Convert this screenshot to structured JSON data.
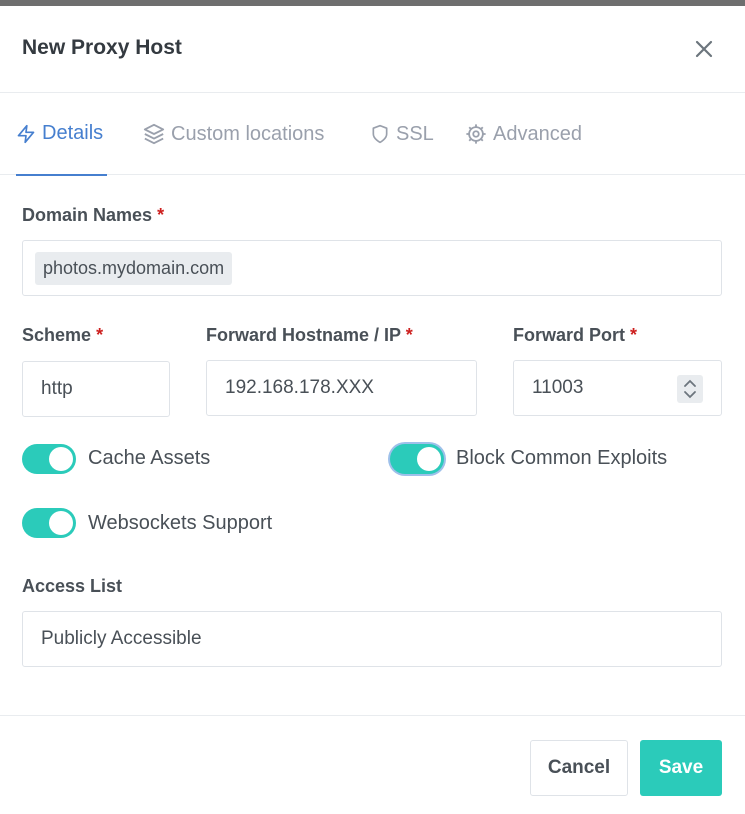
{
  "modal": {
    "title": "New Proxy Host"
  },
  "tabs": [
    {
      "label": "Details",
      "icon": "lightning-icon",
      "active": true
    },
    {
      "label": "Custom locations",
      "icon": "layers-icon",
      "active": false
    },
    {
      "label": "SSL",
      "icon": "shield-icon",
      "active": false
    },
    {
      "label": "Advanced",
      "icon": "gear-icon",
      "active": false
    }
  ],
  "form": {
    "domain_names": {
      "label": "Domain Names",
      "required_mark": "*",
      "tags": [
        "photos.mydomain.com"
      ]
    },
    "scheme": {
      "label": "Scheme",
      "required_mark": "*",
      "value": "http"
    },
    "forward_host": {
      "label": "Forward Hostname / IP",
      "required_mark": "*",
      "value": "192.168.178.XXX"
    },
    "forward_port": {
      "label": "Forward Port",
      "required_mark": "*",
      "value": "11003"
    },
    "cache_assets": {
      "label": "Cache Assets",
      "enabled": true
    },
    "block_exploits": {
      "label": "Block Common Exploits",
      "enabled": true
    },
    "websockets": {
      "label": "Websockets Support",
      "enabled": true
    },
    "access_list": {
      "label": "Access List",
      "value": "Publicly Accessible"
    }
  },
  "footer": {
    "cancel_label": "Cancel",
    "save_label": "Save"
  },
  "colors": {
    "accent": "#467fcf",
    "toggle_on": "#2bcbba",
    "required": "#cd201f"
  }
}
